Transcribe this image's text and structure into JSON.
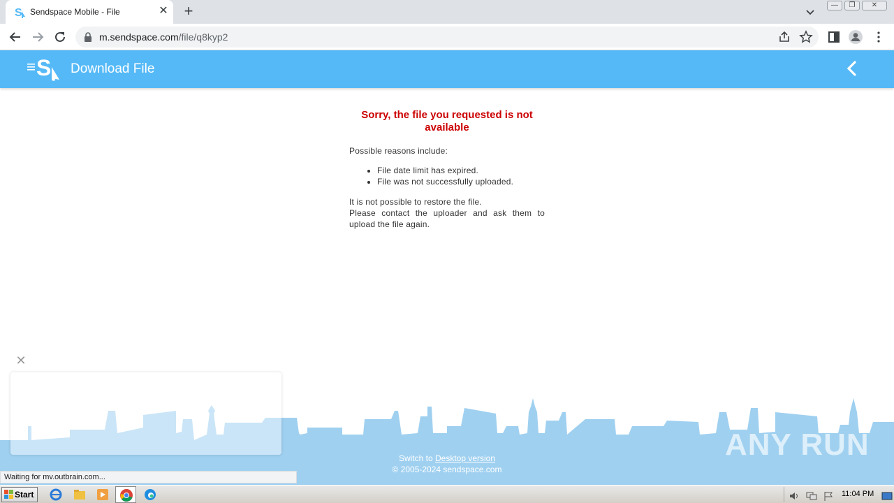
{
  "browser": {
    "tab_title": "Sendspace Mobile - File",
    "url_host": "m.sendspace.com",
    "url_path": "/file/q8kyp2",
    "status_text": "Waiting for mv.outbrain.com..."
  },
  "site": {
    "header_title": "Download File",
    "error_title": "Sorry, the file you requested is not available",
    "reasons_intro": "Possible reasons include:",
    "reasons": [
      "File date limit has expired.",
      "File was not successfully uploaded."
    ],
    "restore_line1": "It is not possible to restore the file.",
    "restore_line2": "Please contact the uploader and ask them to upload the file again.",
    "footer_switch_prefix": "Switch to ",
    "footer_switch_link": "Desktop version",
    "footer_copyright": "© 2005-2024 sendspace.com",
    "accent_color": "#55b9f7",
    "error_color": "#cc0000"
  },
  "watermark": "ANY RUN",
  "taskbar": {
    "start_label": "Start",
    "clock": "11:04 PM"
  }
}
